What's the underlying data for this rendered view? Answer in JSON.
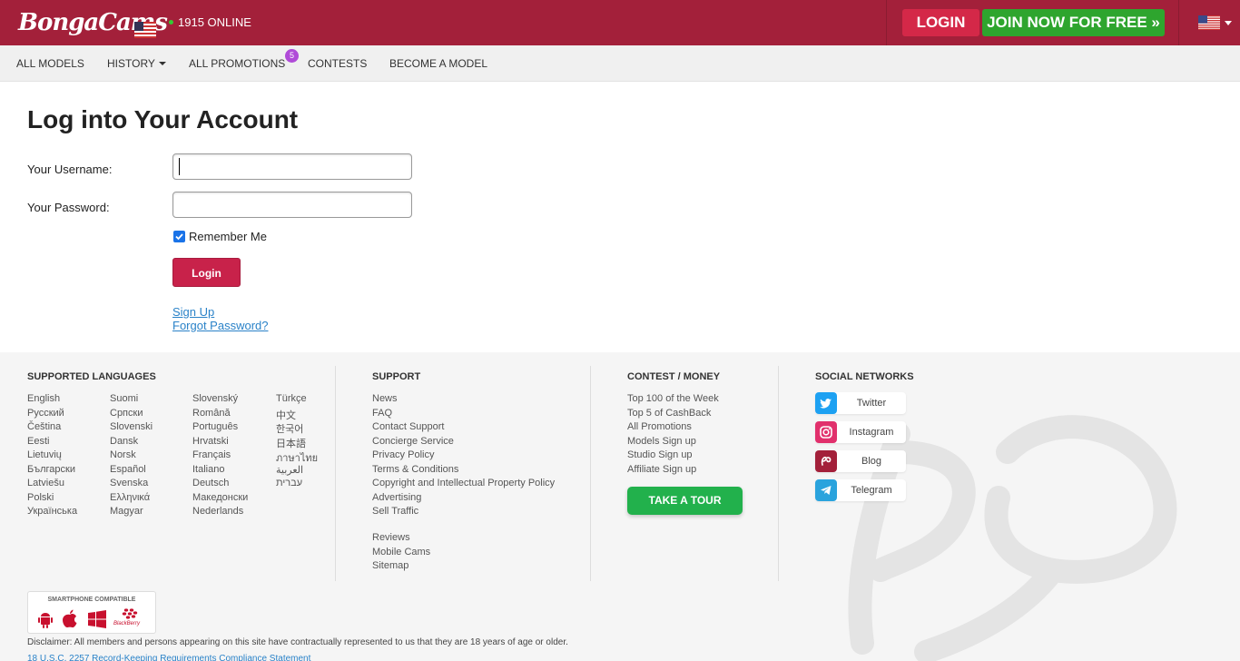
{
  "header": {
    "logo_text": "BongaCams",
    "online_count": "1915",
    "online_label": "ONLINE",
    "login_label": "LOGIN",
    "join_label": "JOIN NOW FOR FREE »"
  },
  "nav": {
    "items": [
      {
        "label": "ALL MODELS"
      },
      {
        "label": "HISTORY"
      },
      {
        "label": "ALL PROMOTIONS"
      },
      {
        "label": "CONTESTS"
      },
      {
        "label": "BECOME A MODEL"
      }
    ],
    "promotions_badge": "5"
  },
  "form": {
    "title": "Log into Your Account",
    "username_label": "Your Username:",
    "password_label": "Your Password:",
    "username_value": "",
    "password_value": "",
    "remember_label": "Remember Me",
    "remember_checked": true,
    "submit_label": "Login",
    "signup_link": "Sign Up",
    "forgot_link": "Forgot Password?"
  },
  "footer": {
    "languages_title": "SUPPORTED LANGUAGES",
    "languages": [
      [
        "English",
        "Русский",
        "Čeština",
        "Eesti",
        "Lietuvių",
        "Български",
        "Latviešu",
        "Polski",
        "Українська"
      ],
      [
        "Suomi",
        "Српски",
        "Slovenski",
        "Dansk",
        "Norsk",
        "Español",
        "Svenska",
        "Ελληνικά",
        "Magyar"
      ],
      [
        "Slovenský",
        "Română",
        "Português",
        "Hrvatski",
        "Français",
        "Italiano",
        "Deutsch",
        "Македонски",
        "Nederlands"
      ],
      [
        "Türkçe",
        "中文",
        "한국어",
        "日本語",
        "ภาษาไทย",
        "العربية",
        "עברית"
      ]
    ],
    "support_title": "SUPPORT",
    "support_links": [
      "News",
      "FAQ",
      "Contact Support",
      "Concierge Service",
      "Privacy Policy",
      "Terms & Conditions",
      "Copyright and Intellectual Property Policy",
      "Advertising",
      "Sell Traffic"
    ],
    "support_links_2": [
      "Reviews",
      "Mobile Cams",
      "Sitemap"
    ],
    "contest_title": "CONTEST / MONEY",
    "contest_links": [
      "Top 100 of the Week",
      "Top 5 of CashBack",
      "All Promotions",
      "Models Sign up",
      "Studio Sign up",
      "Affiliate Sign up"
    ],
    "tour_label": "TAKE A TOUR",
    "social_title": "SOCIAL NETWORKS",
    "social": [
      {
        "label": "Twitter",
        "color": "#1da1f2",
        "icon": "twitter-icon"
      },
      {
        "label": "Instagram",
        "color": "#e1306c",
        "icon": "instagram-icon"
      },
      {
        "label": "Blog",
        "color": "#a3203a",
        "icon": "blog-icon"
      },
      {
        "label": "Telegram",
        "color": "#2aa3dd",
        "icon": "telegram-icon"
      }
    ],
    "smartphone_title": "SMARTPHONE COMPATIBLE",
    "blackberry_label": "BlackBerry",
    "disclaimer": "Disclaimer: All members and persons appearing on this site have contractually represented to us that they are 18 years of age or older.",
    "record_link": "18 U.S.C. 2257 Record-Keeping Requirements Compliance Statement"
  }
}
